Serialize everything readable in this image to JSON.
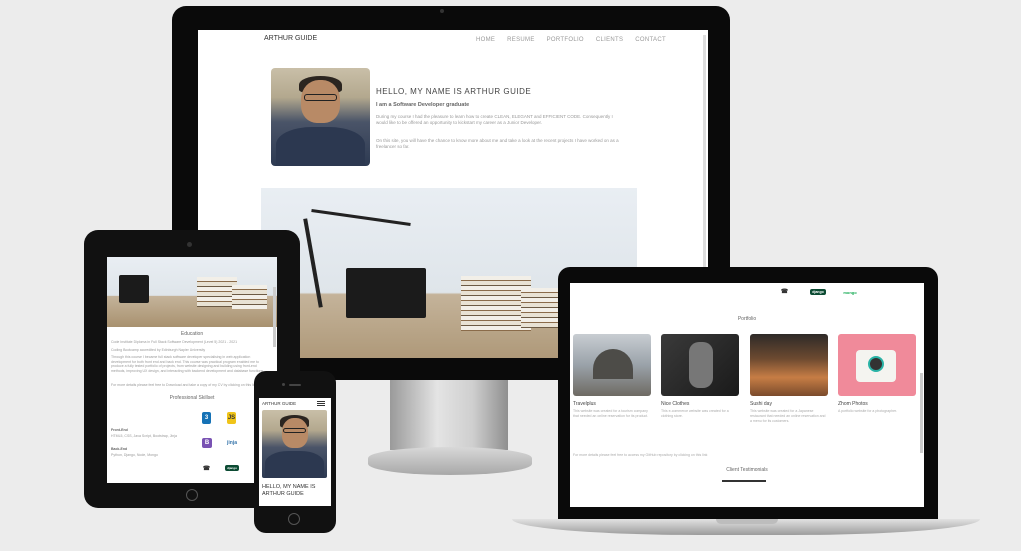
{
  "monitor": {
    "logo": "ARTHUR GUIDE",
    "nav": [
      "HOME",
      "RESUME",
      "PORTFOLIO",
      "CLIENTS",
      "CONTACT"
    ],
    "hello": "HELLO, MY NAME IS ARTHUR GUIDE",
    "subtitle": "I am a Software Developer graduate",
    "para1": "During my course I had the pleasure to learn how to create CLEAN, ELEGANT and EFFICIENT CODE. Consequently I would like to be offered an opportunity to kickstart my career as a Junior Developer.",
    "para2": "On this site, you will have the chance to know more about me and take a look at the recent projects I have worked on as a freelancer so far."
  },
  "tablet": {
    "education_title": "Education",
    "education_text": "Code Institute Diploma in Full Stack Software Development (Level 5) 2021 - 2021",
    "education_sub": "Coding Bootcamp accredited by Edinburgh Napier University",
    "education_para": "Through this course I became full stack software developer specialising in web application development for both front end and back end. This course was practical program enabled me to produce a fully tested portfolio of projects, from website designing and building using front-end methods, improving UX design, and interacting with backend development and database functions.",
    "education_link": "For more details please feel free to Download and take a copy of my CV by clicking on this link",
    "skillset_title": "Professional Skillset",
    "front_end_label": "Front-End",
    "front_end_items": "HTML5, CSS, Java Script, Bootstrap, Jinja",
    "back_end_label": "Back-End",
    "back_end_items": "Python, Django, Node, Mongo"
  },
  "phone": {
    "logo": "ARTHUR GUIDE",
    "hello": "HELLO, MY NAME IS ARTHUR GUIDE"
  },
  "laptop": {
    "portfolio_title": "Portfolio",
    "cards": [
      {
        "title": "Travelplus",
        "text": "This website was created for a tourism company that needed an online reservation for its product."
      },
      {
        "title": "Nice Clothes",
        "text": "This e-commerce website was created for a clothing store."
      },
      {
        "title": "Sushi day",
        "text": "This website was created for a Japanese restaurant that needed an online reservation and a menu for its customers."
      },
      {
        "title": "Zhom Photos",
        "text": "A portfolio website for a photographer."
      }
    ],
    "github_note": "For more details please feel free to access my GitHub repository by clicking on this link",
    "testimonials_title": "Client Testimonials"
  },
  "colors": {
    "device_black": "#0a0a0a",
    "background": "#ececec",
    "html5": "#e44d26",
    "js": "#f0c419",
    "bootstrap": "#7952b3",
    "django": "#0c4b33"
  }
}
